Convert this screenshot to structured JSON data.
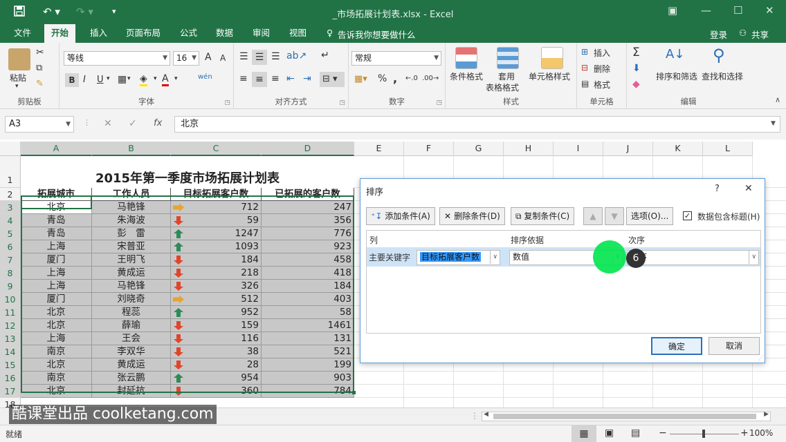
{
  "window": {
    "title": "_市场拓展计划表.xlsx - Excel"
  },
  "tabs": [
    "文件",
    "开始",
    "插入",
    "页面布局",
    "公式",
    "数据",
    "审阅",
    "视图"
  ],
  "tell_me": "告诉我你想要做什么",
  "login": "登录",
  "share": "共享",
  "ribbon": {
    "clipboard": {
      "paste": "粘贴",
      "label": "剪贴板"
    },
    "font": {
      "name": "等线",
      "size": "16",
      "bold": "B",
      "italic": "I",
      "underline": "U",
      "grow": "A",
      "shrink": "A",
      "label": "字体",
      "phonetic": "wén"
    },
    "align": {
      "label": "对齐方式"
    },
    "number": {
      "format": "常规",
      "label": "数字",
      "percent": "%",
      "comma": ","
    },
    "styles": {
      "cond": "条件格式",
      "table1": "套用",
      "table2": "表格格式",
      "cell": "单元格样式",
      "label": "样式"
    },
    "cells": {
      "insert": "插入",
      "delete": "删除",
      "format": "格式",
      "label": "单元格"
    },
    "edit": {
      "sort": "排序和筛选",
      "find": "查找和选择",
      "label": "编辑",
      "sum": "Σ"
    }
  },
  "formula": {
    "name_box": "A3",
    "value": "北京",
    "fx": "fx"
  },
  "columns": [
    "A",
    "B",
    "C",
    "D",
    "E",
    "F",
    "G",
    "H",
    "I",
    "J",
    "K",
    "L"
  ],
  "sheet_title": "2015年第一季度市场拓展计划表",
  "headers": [
    "拓展城市",
    "工作人员",
    "目标拓展客户数",
    "已拓展的客户数"
  ],
  "rows": [
    {
      "city": "北京",
      "person": "马艳锋",
      "target": "712",
      "done": "247",
      "trend": "side"
    },
    {
      "city": "青岛",
      "person": "朱海波",
      "target": "59",
      "done": "356",
      "trend": "down"
    },
    {
      "city": "青岛",
      "person": "彭　雷",
      "target": "1247",
      "done": "776",
      "trend": "up"
    },
    {
      "city": "上海",
      "person": "宋普亚",
      "target": "1093",
      "done": "923",
      "trend": "up"
    },
    {
      "city": "厦门",
      "person": "王明飞",
      "target": "184",
      "done": "458",
      "trend": "down"
    },
    {
      "city": "上海",
      "person": "黄成运",
      "target": "218",
      "done": "418",
      "trend": "down"
    },
    {
      "city": "上海",
      "person": "马艳锋",
      "target": "326",
      "done": "184",
      "trend": "down"
    },
    {
      "city": "厦门",
      "person": "刘晓奇",
      "target": "512",
      "done": "403",
      "trend": "side"
    },
    {
      "city": "北京",
      "person": "程蕊",
      "target": "952",
      "done": "58",
      "trend": "up"
    },
    {
      "city": "北京",
      "person": "薛瑜",
      "target": "159",
      "done": "1461",
      "trend": "down"
    },
    {
      "city": "上海",
      "person": "王会",
      "target": "116",
      "done": "131",
      "trend": "down"
    },
    {
      "city": "南京",
      "person": "李双华",
      "target": "38",
      "done": "521",
      "trend": "down"
    },
    {
      "city": "北京",
      "person": "黄成运",
      "target": "28",
      "done": "199",
      "trend": "down"
    },
    {
      "city": "南京",
      "person": "张云鹏",
      "target": "954",
      "done": "903",
      "trend": "up"
    },
    {
      "city": "北京",
      "person": "封延抗",
      "target": "360",
      "done": "784",
      "trend": "down"
    }
  ],
  "dialog": {
    "title": "排序",
    "help": "?",
    "close": "✕",
    "add": "添加条件(A)",
    "delete": "删除条件(D)",
    "copy": "复制条件(C)",
    "options": "选项(O)...",
    "has_header": "数据包含标题(H)",
    "col_header": "列",
    "sortby_header": "排序依据",
    "order_header": "次序",
    "key_label": "主要关键字",
    "key_value": "目标拓展客户数",
    "sortby_value": "数值",
    "order_value": "升序",
    "ok": "确定",
    "cancel": "取消",
    "step_badge": "6"
  },
  "status": {
    "ready": "就绪",
    "zoom": "100%"
  },
  "watermark": "酷课堂出品 coolketang.com",
  "colors": {
    "brand": "#217346",
    "up": "#2e8b57",
    "down": "#e0452a",
    "side": "#e8a431",
    "highlight": "#00e64d"
  }
}
